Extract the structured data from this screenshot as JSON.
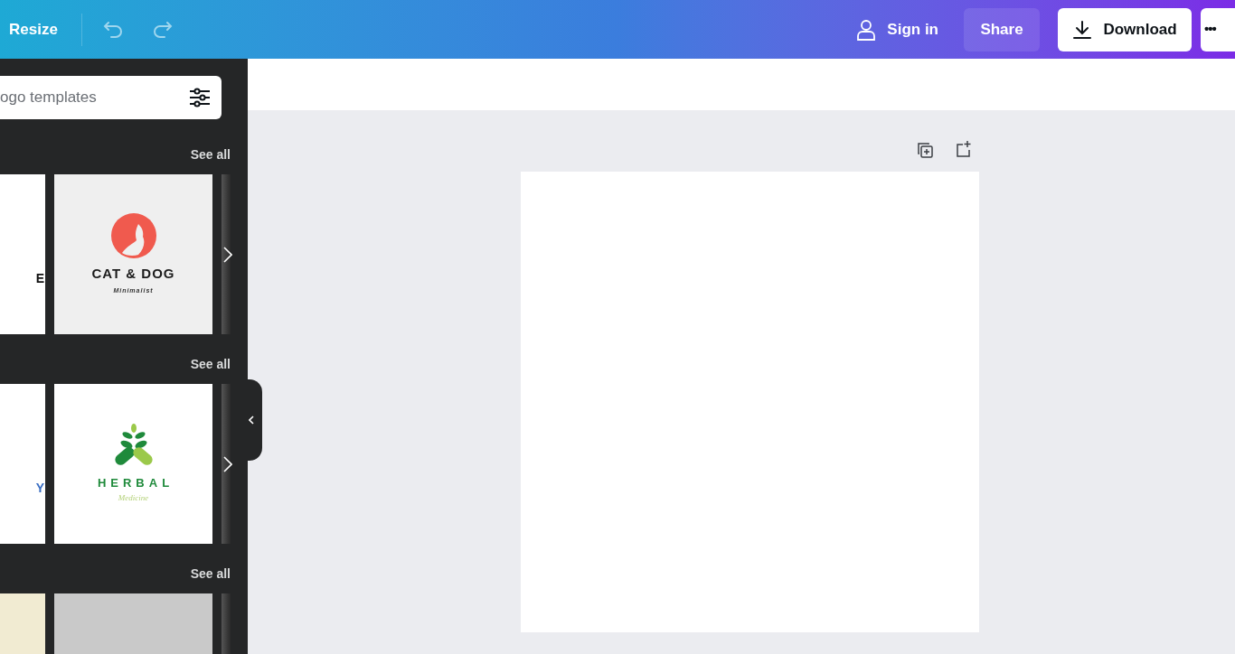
{
  "toolbar": {
    "resize": "Resize",
    "sign_in": "Sign in",
    "share": "Share",
    "download": "Download",
    "more": "•••"
  },
  "search": {
    "placeholder": "ogo templates"
  },
  "sections": [
    {
      "see_all": "See all",
      "templates": [
        {
          "kind": "edge",
          "text": "E",
          "color": "#111111"
        },
        {
          "kind": "catdog",
          "title": "CAT & DOG",
          "subtitle": "Minimalist"
        }
      ]
    },
    {
      "see_all": "See all",
      "templates": [
        {
          "kind": "edge",
          "text": "Y",
          "color": "#3b6fc4"
        },
        {
          "kind": "herbal",
          "title": "HERBAL",
          "subtitle": "Medicine"
        }
      ]
    },
    {
      "see_all": "See all",
      "templates": [
        {
          "kind": "plain",
          "color": "#f1ebd2"
        },
        {
          "kind": "plain",
          "color": "#c9c9c9"
        }
      ]
    }
  ]
}
